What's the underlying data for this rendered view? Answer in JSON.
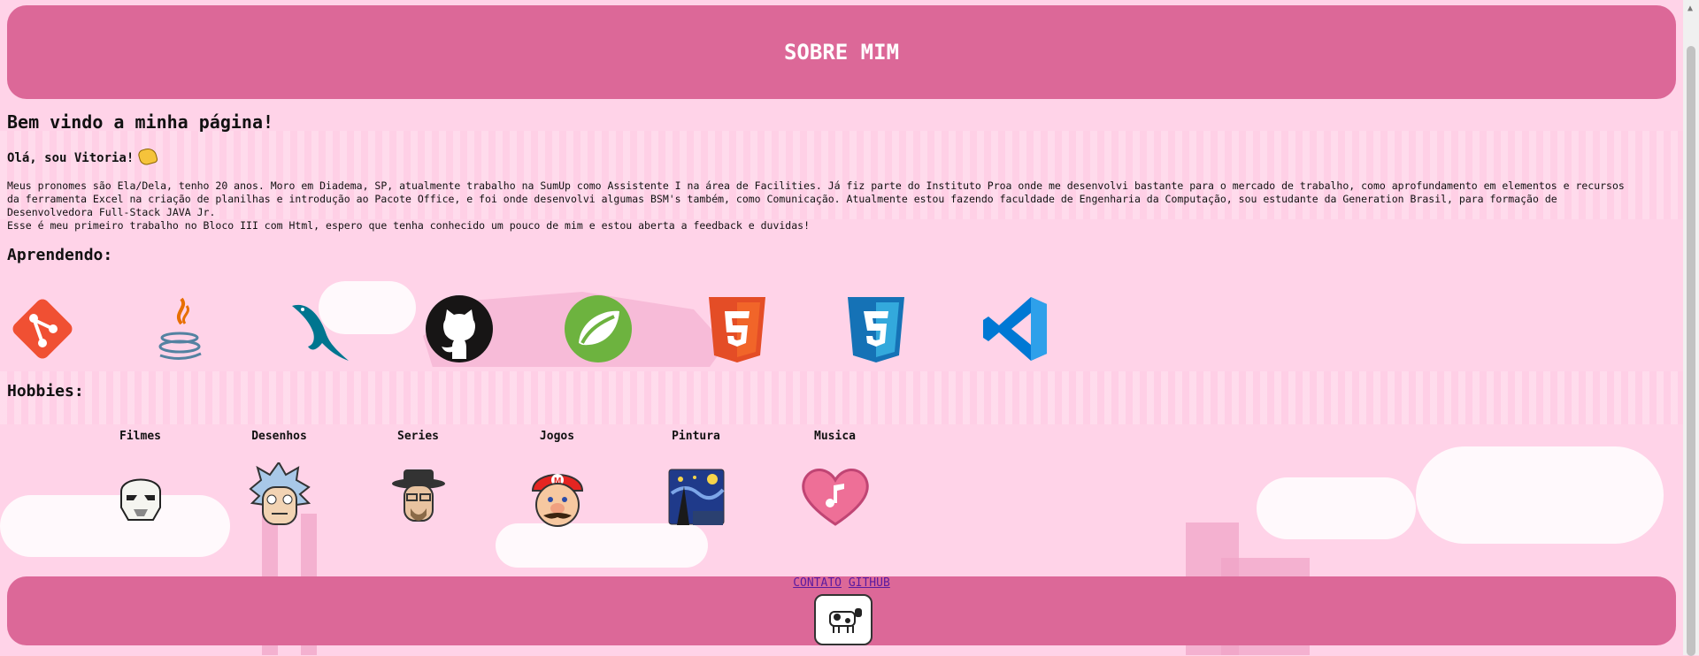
{
  "header": {
    "title": "SOBRE MIM"
  },
  "intro": {
    "welcome": "Bem vindo a minha página!",
    "greeting": "Olá, sou Vitoria!",
    "bio_lines": [
      "Meus pronomes são Ela/Dela, tenho 20 anos. Moro em Diadema, SP, atualmente trabalho na SumUp como Assistente I na área de Facilities. Já fiz parte do Instituto Proa onde me desenvolvi bastante para o mercado de trabalho, como aprofundamento em elementos e recursos",
      "da ferramenta Excel na criação de planilhas e introdução ao Pacote Office, e foi onde desenvolvi algumas BSM's também, como Comunicação. Atualmente estou fazendo faculdade de Engenharia da Computação, sou estudante da Generation Brasil, para formação de",
      "Desenvolvedora Full-Stack JAVA Jr.",
      "Esse é meu primeiro trabalho no Bloco III com Html, espero que tenha conhecido um pouco de mim e estou aberta a feedback e duvidas!"
    ]
  },
  "learning": {
    "heading": "Aprendendo:",
    "icons": [
      "git-icon",
      "java-icon",
      "mysql-icon",
      "github-icon",
      "spring-icon",
      "html5-icon",
      "css3-icon",
      "vscode-icon"
    ]
  },
  "hobbies": {
    "heading": "Hobbies:",
    "items": [
      {
        "label": "Filmes",
        "icon": "stormtrooper-icon"
      },
      {
        "label": "Desenhos",
        "icon": "rick-icon"
      },
      {
        "label": "Series",
        "icon": "heisenberg-icon"
      },
      {
        "label": "Jogos",
        "icon": "mario-icon"
      },
      {
        "label": "Pintura",
        "icon": "starry-night-icon"
      },
      {
        "label": "Musica",
        "icon": "music-heart-icon"
      }
    ]
  },
  "footer": {
    "contact_label": "CONTATO",
    "github_label": "GITHUB",
    "badge_icon": "cow-icon"
  },
  "colors": {
    "accent": "#dc6898",
    "background": "#ffd3e8"
  }
}
